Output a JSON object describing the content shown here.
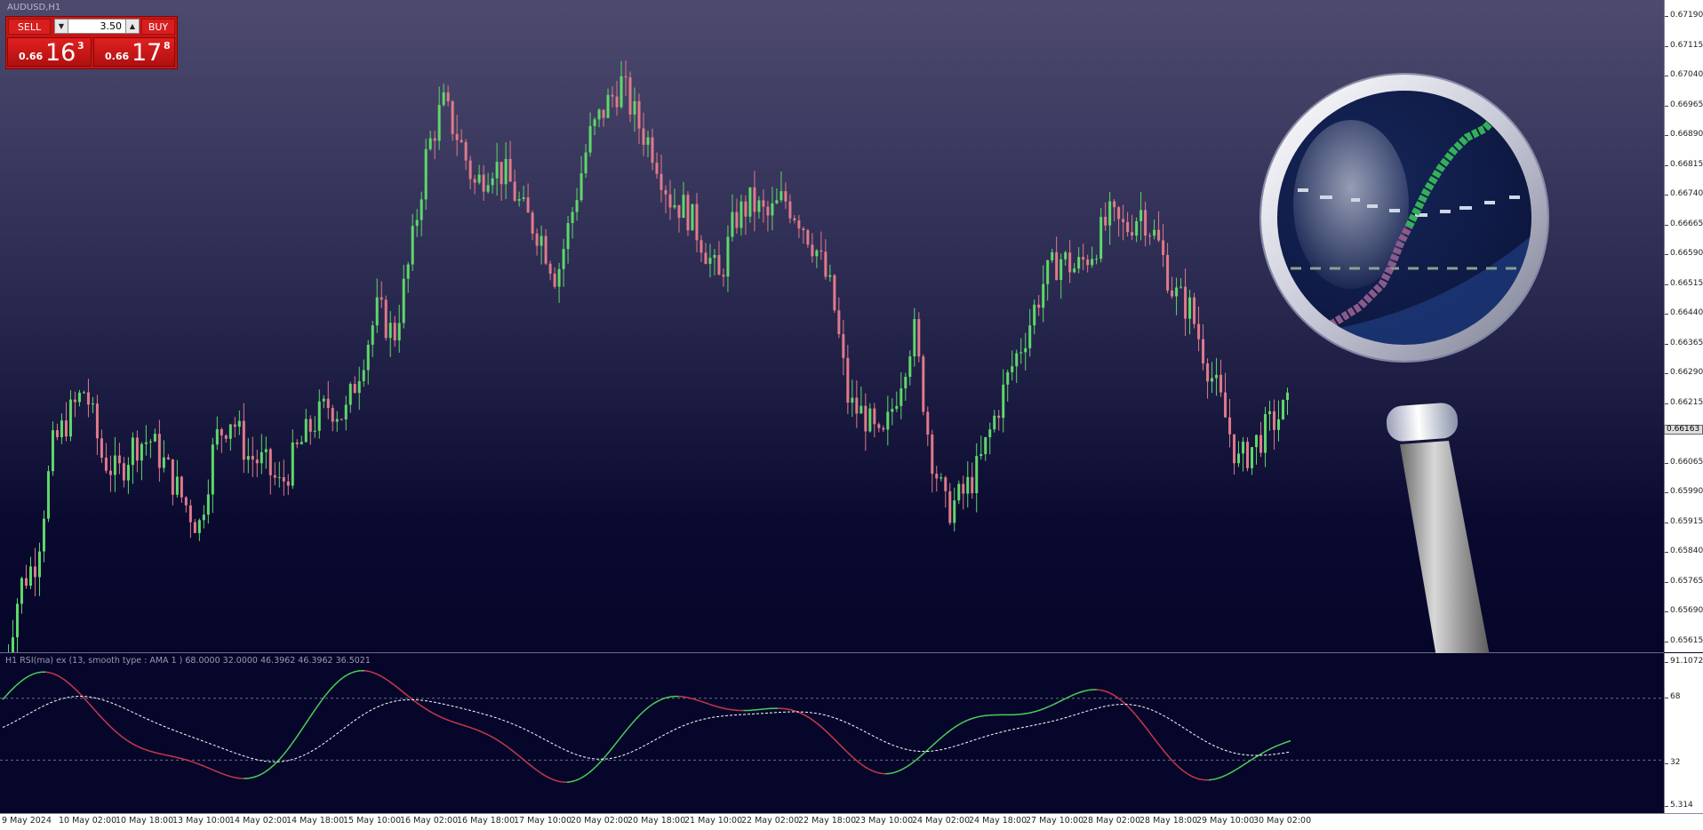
{
  "chart": {
    "symbol": "AUDUSD,H1",
    "rsi_title": "H1 RSI(ma) ex (13, smooth type : AMA  1 ) 68.0000 32.0000 46.3962 46.3962 36.5021",
    "current_price": "0.66163"
  },
  "trade_panel": {
    "sell_label": "SELL",
    "buy_label": "BUY",
    "lot_value": "3.50",
    "sell_price_small": "0.66",
    "sell_price_big": "16",
    "sell_price_sup": "3",
    "buy_price_small": "0.66",
    "buy_price_big": "17",
    "buy_price_sup": "8"
  },
  "price_axis_labels": [
    "0.67190",
    "0.67115",
    "0.67040",
    "0.66965",
    "0.66890",
    "0.66815",
    "0.66740",
    "0.66665",
    "0.66590",
    "0.66515",
    "0.66440",
    "0.66365",
    "0.66290",
    "0.66215",
    "0.66140",
    "0.66065",
    "0.65990",
    "0.65915",
    "0.65840",
    "0.65765",
    "0.65690",
    "0.65615"
  ],
  "rsi_axis_labels": [
    "91.1072",
    "68",
    "32",
    "5.314"
  ],
  "time_axis_labels": [
    "9 May 2024",
    "10 May 02:00",
    "10 May 18:00",
    "13 May 10:00",
    "14 May 02:00",
    "14 May 18:00",
    "15 May 10:00",
    "16 May 02:00",
    "16 May 18:00",
    "17 May 10:00",
    "20 May 02:00",
    "20 May 18:00",
    "21 May 10:00",
    "22 May 02:00",
    "22 May 18:00",
    "23 May 10:00",
    "24 May 02:00",
    "24 May 18:00",
    "27 May 10:00",
    "28 May 02:00",
    "28 May 18:00",
    "29 May 10:00",
    "30 May 02:00"
  ],
  "colors": {
    "bull_candle": "#5fd86a",
    "bear_candle": "#e07a8a",
    "rsi_up": "#4ccf5a",
    "rsi_down": "#c8384a",
    "rsi_signal": "#ffffff"
  },
  "chart_data": {
    "type": "candlestick",
    "ylim": [
      0.65615,
      0.6719
    ],
    "close_path": [
      0.6555,
      0.6575,
      0.6582,
      0.661,
      0.6618,
      0.6625,
      0.6608,
      0.6603,
      0.6611,
      0.6612,
      0.6605,
      0.6597,
      0.659,
      0.6612,
      0.6618,
      0.6608,
      0.6606,
      0.66,
      0.6609,
      0.6616,
      0.6621,
      0.6618,
      0.6632,
      0.6645,
      0.6638,
      0.6658,
      0.6684,
      0.6697,
      0.6688,
      0.6676,
      0.6682,
      0.6678,
      0.6669,
      0.6664,
      0.6653,
      0.667,
      0.6688,
      0.6696,
      0.6702,
      0.6692,
      0.6685,
      0.6673,
      0.667,
      0.6662,
      0.6652,
      0.6668,
      0.6672,
      0.6668,
      0.6673,
      0.6668,
      0.666,
      0.6648,
      0.6621,
      0.6618,
      0.661,
      0.6625,
      0.664,
      0.661,
      0.6594,
      0.6598,
      0.6605,
      0.6618,
      0.663,
      0.664,
      0.6652,
      0.6658,
      0.6655,
      0.666,
      0.6668,
      0.6665,
      0.667,
      0.6662,
      0.6649,
      0.6645,
      0.6632,
      0.662,
      0.6606,
      0.6611,
      0.6616,
      0.662
    ],
    "rsi_levels": [
      68,
      32
    ],
    "rsi_range": [
      5.314,
      91.1072
    ]
  },
  "magnifier": {
    "icon": "magnifying-glass-icon"
  }
}
